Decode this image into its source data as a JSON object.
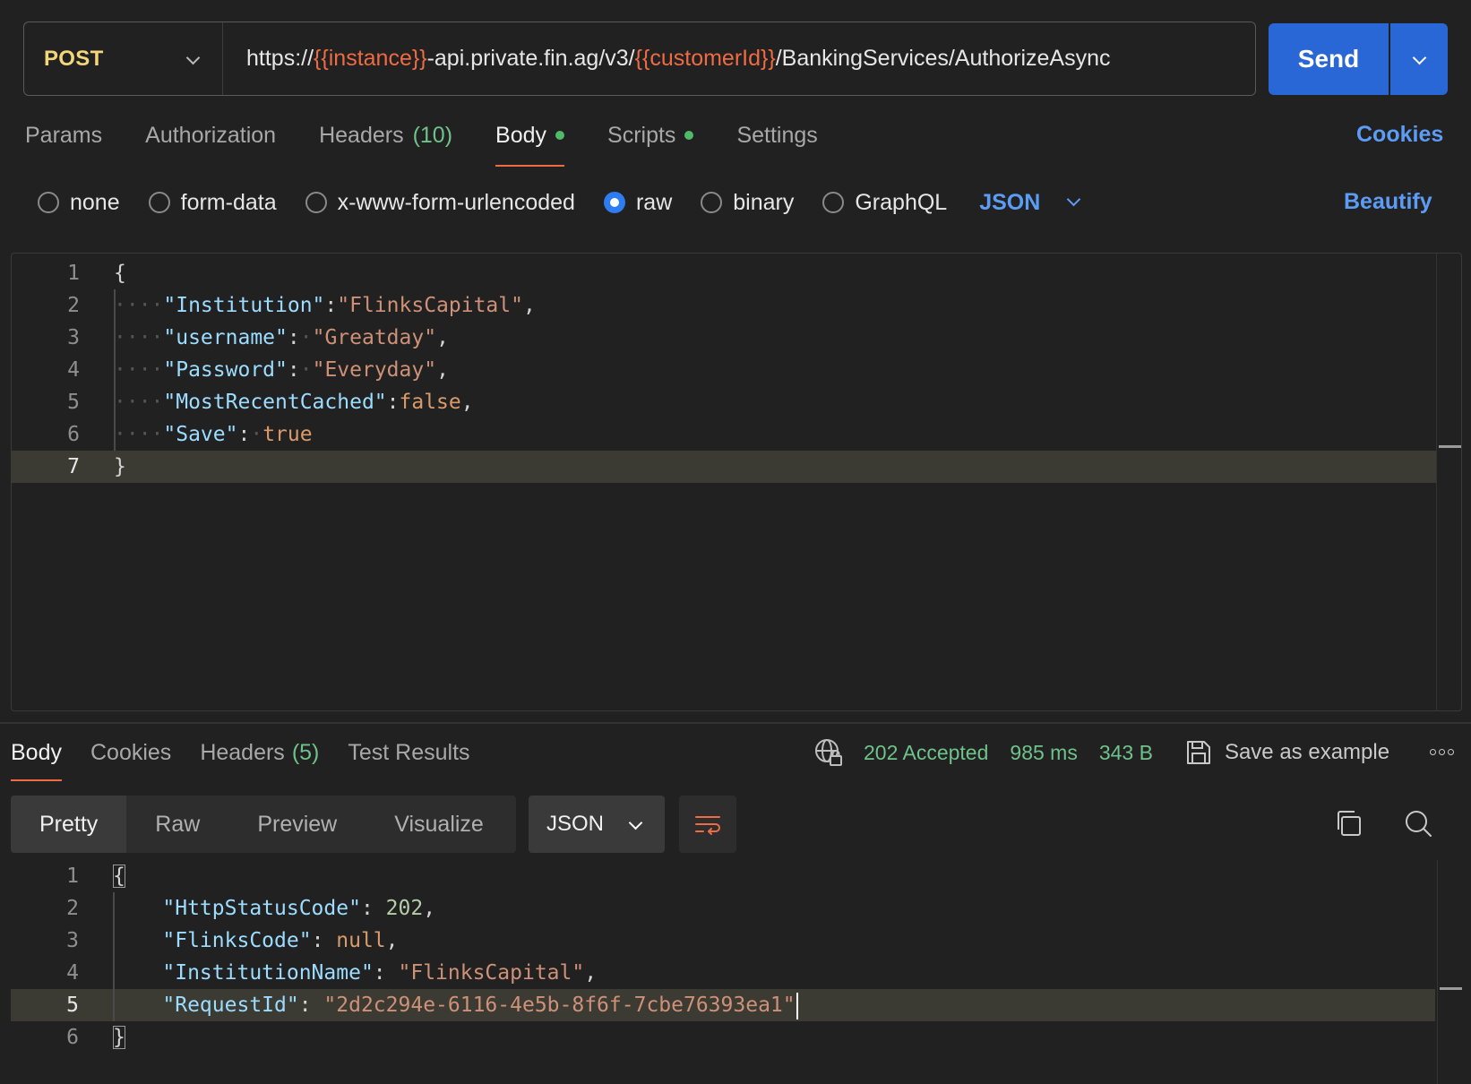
{
  "request": {
    "method": "POST",
    "url_parts": [
      {
        "text": "https://",
        "var": false
      },
      {
        "text": "{{instance}}",
        "var": true
      },
      {
        "text": "-api.private.fin.ag/v3/",
        "var": false
      },
      {
        "text": "{{customerId}}",
        "var": true
      },
      {
        "text": "/BankingServices/AuthorizeAsync",
        "var": false
      }
    ],
    "send_label": "Send"
  },
  "req_tabs": {
    "params": "Params",
    "authorization": "Authorization",
    "headers": "Headers",
    "headers_count": "(10)",
    "body": "Body",
    "scripts": "Scripts",
    "settings": "Settings",
    "cookies": "Cookies"
  },
  "body_types": {
    "none": "none",
    "form_data": "form-data",
    "urlencoded": "x-www-form-urlencoded",
    "raw": "raw",
    "binary": "binary",
    "graphql": "GraphQL",
    "selected_format": "JSON",
    "beautify": "Beautify"
  },
  "request_body": [
    {
      "num": "1",
      "tokens": [
        {
          "t": "{",
          "c": "p"
        }
      ]
    },
    {
      "num": "2",
      "tokens": [
        {
          "t": "····",
          "c": "ws"
        },
        {
          "t": "\"Institution\"",
          "c": "k"
        },
        {
          "t": ":",
          "c": "p"
        },
        {
          "t": "\"FlinksCapital\"",
          "c": "s"
        },
        {
          "t": ",",
          "c": "p"
        }
      ]
    },
    {
      "num": "3",
      "tokens": [
        {
          "t": "····",
          "c": "ws"
        },
        {
          "t": "\"username\"",
          "c": "k"
        },
        {
          "t": ":",
          "c": "p"
        },
        {
          "t": "·",
          "c": "ws"
        },
        {
          "t": "\"Greatday\"",
          "c": "s"
        },
        {
          "t": ",",
          "c": "p"
        }
      ]
    },
    {
      "num": "4",
      "tokens": [
        {
          "t": "····",
          "c": "ws"
        },
        {
          "t": "\"Password\"",
          "c": "k"
        },
        {
          "t": ":",
          "c": "p"
        },
        {
          "t": "·",
          "c": "ws"
        },
        {
          "t": "\"Everyday\"",
          "c": "s"
        },
        {
          "t": ",",
          "c": "p"
        }
      ]
    },
    {
      "num": "5",
      "tokens": [
        {
          "t": "····",
          "c": "ws"
        },
        {
          "t": "\"MostRecentCached\"",
          "c": "k"
        },
        {
          "t": ":",
          "c": "p"
        },
        {
          "t": "false",
          "c": "b"
        },
        {
          "t": ",",
          "c": "p"
        }
      ]
    },
    {
      "num": "6",
      "tokens": [
        {
          "t": "····",
          "c": "ws"
        },
        {
          "t": "\"Save\"",
          "c": "k"
        },
        {
          "t": ":",
          "c": "p"
        },
        {
          "t": "·",
          "c": "ws"
        },
        {
          "t": "true",
          "c": "b"
        }
      ]
    },
    {
      "num": "7",
      "tokens": [
        {
          "t": "}",
          "c": "p"
        }
      ]
    }
  ],
  "res_tabs": {
    "body": "Body",
    "cookies": "Cookies",
    "headers": "Headers",
    "headers_count": "(5)",
    "test_results": "Test Results"
  },
  "status": {
    "code": "202 Accepted",
    "time": "985 ms",
    "size": "343 B",
    "save_example": "Save as example"
  },
  "view_modes": {
    "pretty": "Pretty",
    "raw": "Raw",
    "preview": "Preview",
    "visualize": "Visualize",
    "format": "JSON"
  },
  "response_body": [
    {
      "num": "1",
      "tokens": [
        {
          "t": "{",
          "c": "p"
        }
      ]
    },
    {
      "num": "2",
      "tokens": [
        {
          "t": "    ",
          "c": "p"
        },
        {
          "t": "\"HttpStatusCode\"",
          "c": "k"
        },
        {
          "t": ": ",
          "c": "p"
        },
        {
          "t": "202",
          "c": "n"
        },
        {
          "t": ",",
          "c": "p"
        }
      ]
    },
    {
      "num": "3",
      "tokens": [
        {
          "t": "    ",
          "c": "p"
        },
        {
          "t": "\"FlinksCode\"",
          "c": "k"
        },
        {
          "t": ": ",
          "c": "p"
        },
        {
          "t": "null",
          "c": "b"
        },
        {
          "t": ",",
          "c": "p"
        }
      ]
    },
    {
      "num": "4",
      "tokens": [
        {
          "t": "    ",
          "c": "p"
        },
        {
          "t": "\"InstitutionName\"",
          "c": "k"
        },
        {
          "t": ": ",
          "c": "p"
        },
        {
          "t": "\"FlinksCapital\"",
          "c": "s"
        },
        {
          "t": ",",
          "c": "p"
        }
      ]
    },
    {
      "num": "5",
      "tokens": [
        {
          "t": "    ",
          "c": "p"
        },
        {
          "t": "\"RequestId\"",
          "c": "k"
        },
        {
          "t": ": ",
          "c": "p"
        },
        {
          "t": "\"2d2c294e-6116-4e5b-8f6f-7cbe76393ea1\"",
          "c": "s"
        }
      ]
    },
    {
      "num": "6",
      "tokens": [
        {
          "t": "}",
          "c": "p"
        }
      ]
    }
  ],
  "colors": {
    "accent_orange": "#ee6b43",
    "send_blue": "#2967d6",
    "link_blue": "#5d9cf5",
    "success_green": "#6fc28a"
  },
  "icons": {
    "method_dropdown": "chevron-down-icon",
    "send_dropdown": "chevron-down-icon",
    "network": "globe-icon",
    "save": "save-icon",
    "more": "more-icon",
    "wrap": "wrap-lines-icon",
    "copy": "copy-icon",
    "search": "search-icon"
  }
}
